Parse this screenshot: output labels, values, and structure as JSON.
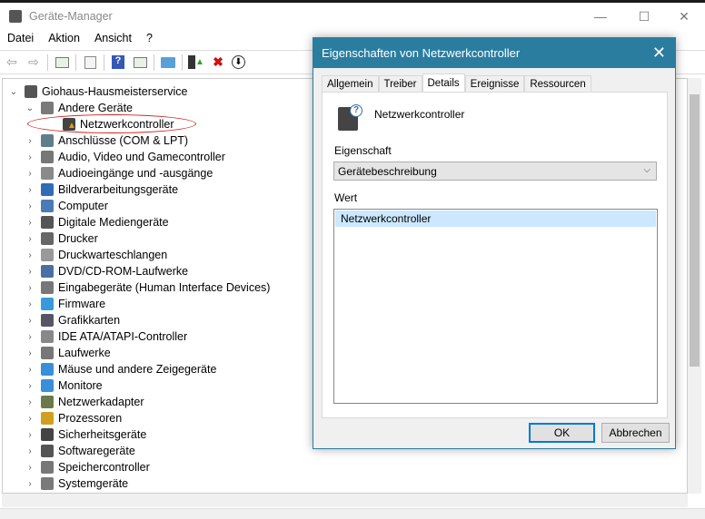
{
  "window": {
    "title": "Geräte-Manager",
    "minimize": "—",
    "maximize": "☐",
    "close": "✕"
  },
  "menu": [
    "Datei",
    "Aktion",
    "Ansicht",
    "?"
  ],
  "toolbar": {
    "back": "⇦",
    "forward": "⇨",
    "uninstall": "✖",
    "update": "⬇"
  },
  "tree": {
    "root": "Giohaus-Hausmeisterservice",
    "items": [
      {
        "label": "Andere Geräte",
        "expanded": true,
        "level": 1
      },
      {
        "label": "Netzwerkcontroller",
        "level": 2,
        "warning": true
      },
      {
        "label": "Anschlüsse (COM & LPT)",
        "level": 1
      },
      {
        "label": "Audio, Video und Gamecontroller",
        "level": 1
      },
      {
        "label": "Audioeingänge und -ausgänge",
        "level": 1
      },
      {
        "label": "Bildverarbeitungsgeräte",
        "level": 1
      },
      {
        "label": "Computer",
        "level": 1
      },
      {
        "label": "Digitale Mediengeräte",
        "level": 1
      },
      {
        "label": "Drucker",
        "level": 1
      },
      {
        "label": "Druckwarteschlangen",
        "level": 1
      },
      {
        "label": "DVD/CD-ROM-Laufwerke",
        "level": 1
      },
      {
        "label": "Eingabegeräte (Human Interface Devices)",
        "level": 1
      },
      {
        "label": "Firmware",
        "level": 1
      },
      {
        "label": "Grafikkarten",
        "level": 1
      },
      {
        "label": "IDE ATA/ATAPI-Controller",
        "level": 1
      },
      {
        "label": "Laufwerke",
        "level": 1
      },
      {
        "label": "Mäuse und andere Zeigegeräte",
        "level": 1
      },
      {
        "label": "Monitore",
        "level": 1
      },
      {
        "label": "Netzwerkadapter",
        "level": 1
      },
      {
        "label": "Prozessoren",
        "level": 1
      },
      {
        "label": "Sicherheitsgeräte",
        "level": 1
      },
      {
        "label": "Softwaregeräte",
        "level": 1
      },
      {
        "label": "Speichercontroller",
        "level": 1
      },
      {
        "label": "Systemgeräte",
        "level": 1
      }
    ]
  },
  "dialog": {
    "title": "Eigenschaften von Netzwerkcontroller",
    "close": "✕",
    "tabs": [
      "Allgemein",
      "Treiber",
      "Details",
      "Ereignisse",
      "Ressourcen"
    ],
    "active_tab": "Details",
    "device_name": "Netzwerkcontroller",
    "property_label": "Eigenschaft",
    "property_value": "Gerätebeschreibung",
    "value_label": "Wert",
    "values": [
      "Netzwerkcontroller"
    ],
    "ok": "OK",
    "cancel": "Abbrechen"
  },
  "colors": {
    "accent": "#2b7da0",
    "highlight": "#cce8ff",
    "annotation": "#d02020"
  }
}
